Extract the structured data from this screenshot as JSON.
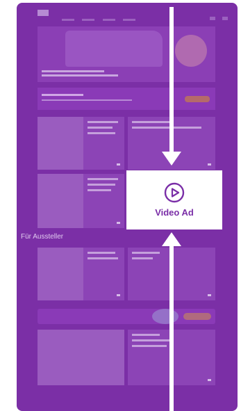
{
  "ad_overlay": {
    "label": "Video Ad",
    "icon": "play-circle-icon",
    "accent_color": "#7a2ea7"
  },
  "page": {
    "section_title": "Für Aussteller",
    "overlay_color": "#7b2fa6"
  },
  "arrows": {
    "color": "#ffffff",
    "top_direction": "down",
    "bottom_direction": "up"
  }
}
